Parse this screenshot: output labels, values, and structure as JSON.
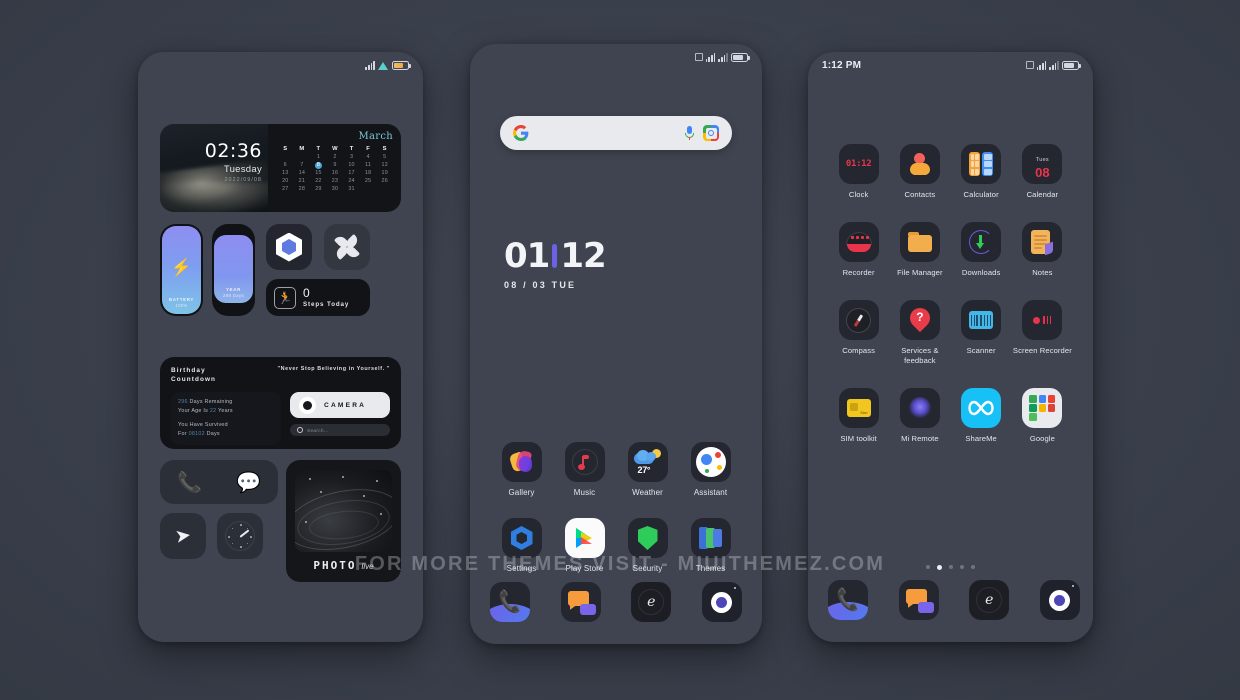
{
  "watermark": "FOR MORE THEMES VISIT - MIUITHEMEZ.COM",
  "phone_left": {
    "status": {
      "signal": "signal-bars",
      "wifi": "wifi-icon",
      "battery": "battery-icon"
    },
    "clock_widget": {
      "time": "02:36",
      "day": "Tuesday",
      "date": "2022/09/08"
    },
    "calendar_widget": {
      "month": "March",
      "weekdays": [
        "S",
        "M",
        "T",
        "W",
        "T",
        "F",
        "S"
      ],
      "days": [
        "",
        "",
        "1",
        "2",
        "3",
        "4",
        "5",
        "6",
        "7",
        "8",
        "9",
        "10",
        "11",
        "12",
        "13",
        "14",
        "15",
        "16",
        "17",
        "18",
        "19",
        "20",
        "21",
        "22",
        "23",
        "24",
        "25",
        "26",
        "27",
        "28",
        "29",
        "30",
        "31"
      ],
      "today": "8"
    },
    "battery_widget": {
      "label": "BATTERY",
      "value": "100%"
    },
    "year_widget": {
      "label": "YEAR",
      "value": "298 Days"
    },
    "steps_widget": {
      "count": "0",
      "label": "Steps Today",
      "icon": "runner-icon"
    },
    "birthday_widget": {
      "title_line1": "Birthday",
      "title_line2": "Countdown",
      "quote": "\"Never Stop Believing in Yourself. \"",
      "days_remaining_num": "296",
      "days_remaining_text": "Days Remaining",
      "age_prefix": "Your Age Is",
      "age_num": "22",
      "age_suffix": "Years",
      "survived_line": "You Have Survived",
      "survived_prefix": "For",
      "survived_num": "08102",
      "survived_suffix": "Days",
      "camera_label": "CAMERA",
      "search_placeholder": "Search..."
    },
    "photo_widget": {
      "title": "PHOTO",
      "subtitle": "live"
    }
  },
  "phone_mid": {
    "search": {
      "placeholder": "",
      "google_icon": "google-g-icon",
      "mic_icon": "microphone-icon",
      "lens_icon": "google-lens-icon"
    },
    "clock": {
      "hours": "01",
      "minutes": "12",
      "date": "08 / 03   TUE",
      "separator_color": "#6b62e8"
    },
    "apps": [
      {
        "label": "Gallery",
        "icon": "gallery-icon"
      },
      {
        "label": "Music",
        "icon": "music-icon"
      },
      {
        "label": "Weather",
        "icon": "weather-icon",
        "temp": "27°"
      },
      {
        "label": "Assistant",
        "icon": "assistant-icon"
      },
      {
        "label": "Settings",
        "icon": "settings-icon"
      },
      {
        "label": "Play Store",
        "icon": "play-store-icon"
      },
      {
        "label": "Security",
        "icon": "security-shield-icon"
      },
      {
        "label": "Themes",
        "icon": "themes-icon"
      }
    ],
    "dock": [
      {
        "name": "phone-dock-icon"
      },
      {
        "name": "messages-dock-icon"
      },
      {
        "name": "browser-dock-icon"
      },
      {
        "name": "camera-dock-icon"
      }
    ]
  },
  "phone_right": {
    "status": {
      "time": "1:12 PM"
    },
    "apps": [
      {
        "label": "Clock",
        "icon": "clock-icon",
        "badge": "01:12"
      },
      {
        "label": "Contacts",
        "icon": "contacts-icon"
      },
      {
        "label": "Calculator",
        "icon": "calculator-icon"
      },
      {
        "label": "Calendar",
        "icon": "calendar-icon",
        "weekday": "Tues",
        "day": "08"
      },
      {
        "label": "Recorder",
        "icon": "recorder-icon"
      },
      {
        "label": "File Manager",
        "icon": "folder-icon"
      },
      {
        "label": "Downloads",
        "icon": "download-icon"
      },
      {
        "label": "Notes",
        "icon": "notes-icon"
      },
      {
        "label": "Compass",
        "icon": "compass-icon"
      },
      {
        "label": "Services & feedback",
        "icon": "help-pin-icon"
      },
      {
        "label": "Scanner",
        "icon": "barcode-scanner-icon"
      },
      {
        "label": "Screen Recorder",
        "icon": "screen-recorder-icon"
      },
      {
        "label": "SIM toolkit",
        "icon": "sim-card-icon"
      },
      {
        "label": "Mi Remote",
        "icon": "remote-icon"
      },
      {
        "label": "ShareMe",
        "icon": "shareme-infinity-icon"
      },
      {
        "label": "Google",
        "icon": "google-folder-icon"
      }
    ],
    "page_dots": {
      "total": 5,
      "active_index": 1
    },
    "dock": [
      {
        "name": "phone-dock-icon"
      },
      {
        "name": "messages-dock-icon"
      },
      {
        "name": "browser-dock-icon"
      },
      {
        "name": "camera-dock-icon"
      }
    ]
  }
}
